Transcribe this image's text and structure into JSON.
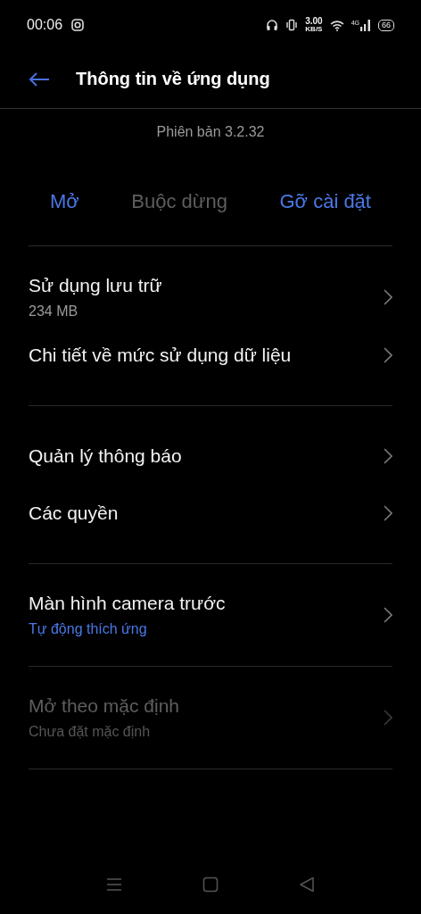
{
  "status_bar": {
    "time": "00:06",
    "speed": "3.00",
    "speed_unit": "KB/S",
    "network_type": "4G",
    "battery": "66"
  },
  "header": {
    "title": "Thông tin về ứng dụng"
  },
  "app": {
    "version": "Phiên bản 3.2.32"
  },
  "actions": [
    {
      "label": "Mở",
      "disabled": false
    },
    {
      "label": "Buộc dừng",
      "disabled": true
    },
    {
      "label": "Gỡ cài đặt",
      "disabled": false
    }
  ],
  "groups": [
    {
      "items": [
        {
          "title": "Sử dụng lưu trữ",
          "subtitle": "234 MB",
          "accent": false,
          "disabled": false
        },
        {
          "title": "Chi tiết về mức sử dụng dữ liệu",
          "disabled": false
        }
      ]
    },
    {
      "items": [
        {
          "title": "Quản lý thông báo",
          "disabled": false
        },
        {
          "title": "Các quyền",
          "disabled": false
        }
      ]
    },
    {
      "items": [
        {
          "title": "Màn hình camera trước",
          "subtitle": "Tự động thích ứng",
          "accent": true,
          "disabled": false
        }
      ]
    },
    {
      "items": [
        {
          "title": "Mở theo mặc định",
          "subtitle": "Chưa đặt mặc định",
          "disabled": true
        }
      ]
    }
  ]
}
